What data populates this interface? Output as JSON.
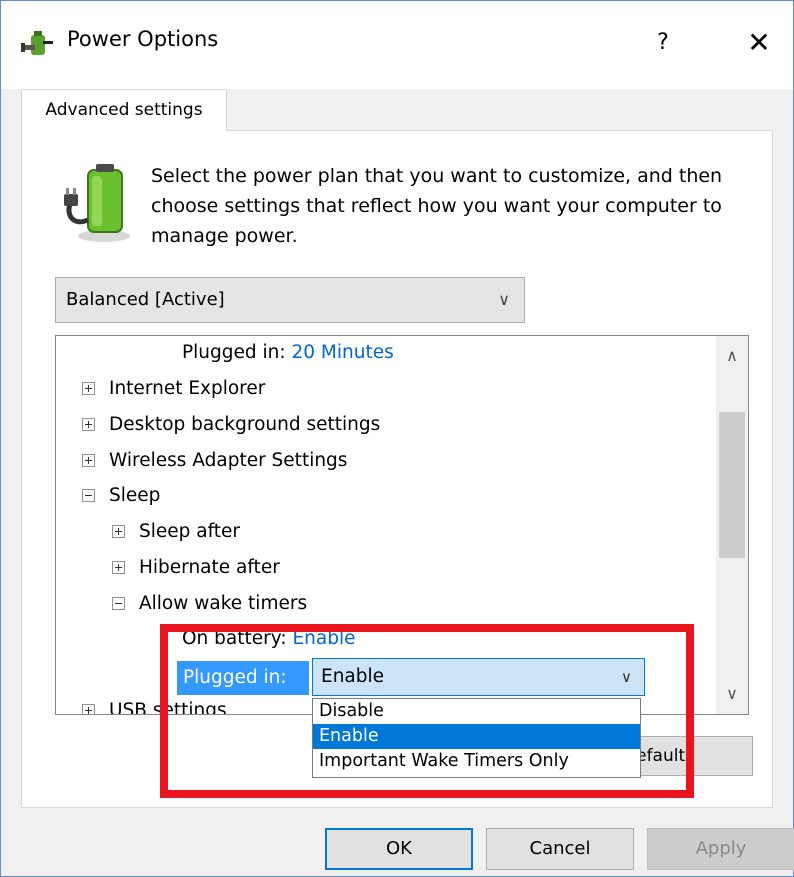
{
  "window": {
    "title": "Power Options",
    "help_label": "?",
    "close_label": "✕"
  },
  "tab": {
    "label": "Advanced settings"
  },
  "description": "Select the power plan that you want to customize, and then choose settings that reflect how you want your computer to manage power.",
  "plan_select": {
    "value": "Balanced [Active]"
  },
  "tree": {
    "top_value_label": "Plugged in:",
    "top_value": "20 Minutes",
    "items": [
      {
        "label": "Internet Explorer",
        "expanded": false
      },
      {
        "label": "Desktop background settings",
        "expanded": false
      },
      {
        "label": "Wireless Adapter Settings",
        "expanded": false
      },
      {
        "label": "Sleep",
        "expanded": true
      }
    ],
    "sleep_children": [
      {
        "label": "Sleep after",
        "expanded": false
      },
      {
        "label": "Hibernate after",
        "expanded": false
      },
      {
        "label": "Allow wake timers",
        "expanded": true
      }
    ],
    "on_battery_label": "On battery:",
    "on_battery_value": "Enable",
    "plugged_in_label": "Plugged in:",
    "cut_item_label": "USB settings"
  },
  "value_select": {
    "value": "Enable",
    "options": [
      "Disable",
      "Enable",
      "Important Wake Timers Only"
    ],
    "selected": "Enable"
  },
  "restore_button_label": "Restore plan defaults",
  "buttons": {
    "ok": "OK",
    "cancel": "Cancel",
    "apply": "Apply"
  },
  "colors": {
    "accent": "#0078d7",
    "link": "#0066cc",
    "highlight": "#e8141e"
  }
}
